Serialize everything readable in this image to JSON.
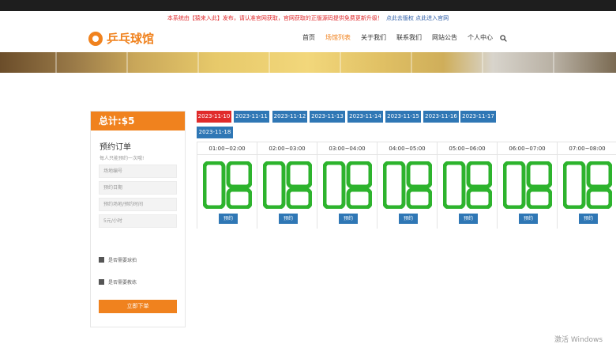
{
  "notice": {
    "text": "本系统由【猿来入此】发布，请认准官网获取，官网获取的正版源码提供免费更新升级！",
    "link": "点此去版权 点此进入官网"
  },
  "brand": {
    "name": "乒乓球馆"
  },
  "nav": [
    {
      "label": "首页",
      "active": false
    },
    {
      "label": "场馆列表",
      "active": true
    },
    {
      "label": "关于我们",
      "active": false
    },
    {
      "label": "联系我们",
      "active": false
    },
    {
      "label": "网站公告",
      "active": false
    },
    {
      "label": "个人中心",
      "active": false
    }
  ],
  "sidebar": {
    "total": "总计:$5",
    "title": "预约订单",
    "subtitle": "每人只能预约一次哦!",
    "fields": [
      {
        "placeholder": "场地编号"
      },
      {
        "placeholder": "预约日期"
      },
      {
        "placeholder": "预约场地/预约时间"
      },
      {
        "placeholder": "5元/小时"
      }
    ],
    "checks": [
      "是否需要球拍",
      "是否需要教练"
    ],
    "submit": "立即下单"
  },
  "dates": [
    {
      "label": "2023-11-10",
      "active": true
    },
    {
      "label": "2023-11-11",
      "active": false
    },
    {
      "label": "2023-11-12",
      "active": false
    },
    {
      "label": "2023-11-13",
      "active": false
    },
    {
      "label": "2023-11-14",
      "active": false
    },
    {
      "label": "2023-11-15",
      "active": false
    },
    {
      "label": "2023-11-16",
      "active": false
    },
    {
      "label": "2023-11-17",
      "active": false
    },
    {
      "label": "2023-11-18",
      "active": false
    }
  ],
  "slots": [
    {
      "time": "01:00~02:00",
      "button": "预约"
    },
    {
      "time": "02:00~03:00",
      "button": "预约"
    },
    {
      "time": "03:00~04:00",
      "button": "预约"
    },
    {
      "time": "04:00~05:00",
      "button": "预约"
    },
    {
      "time": "05:00~06:00",
      "button": "预约"
    },
    {
      "time": "06:00~07:00",
      "button": "预约"
    },
    {
      "time": "07:00~08:00",
      "button": "预约"
    }
  ],
  "watermark": "激活 Windows",
  "colors": {
    "accent": "#f0821e",
    "primary": "#2f77b5",
    "active_date": "#e02b2b",
    "slot_icon": "#2db32d"
  },
  "icons": {
    "search": "search-icon",
    "logo": "ping-pong-ball-icon",
    "slot": "court-table-icon"
  }
}
